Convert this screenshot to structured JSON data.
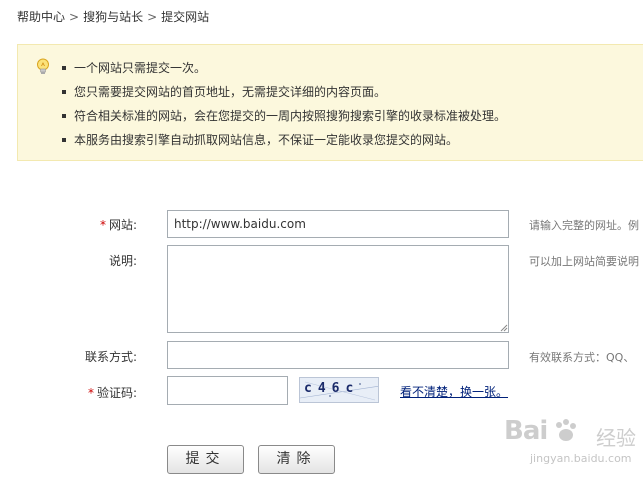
{
  "breadcrumb": {
    "items": [
      "帮助中心",
      "搜狗与站长",
      "提交网站"
    ],
    "separator": ">"
  },
  "notice": {
    "icon": "lightbulb-icon",
    "items": [
      "一个网站只需提交一次。",
      "您只需要提交网站的首页地址，无需提交详细的内容页面。",
      "符合相关标准的网站，会在您提交的一周内按照搜狗搜索引擎的收录标准被处理。",
      "本服务由搜索引擎自动抓取网站信息，不保证一定能收录您提交的网站。"
    ]
  },
  "form": {
    "required_mark": "*",
    "site": {
      "label": "网站:",
      "value": "http://www.baidu.com",
      "hint": "请输入完整的网址。例"
    },
    "description": {
      "label": "说明:",
      "value": "",
      "hint": "可以加上网站简要说明"
    },
    "contact": {
      "label": "联系方式:",
      "value": "",
      "hint": "有效联系方式：QQ、"
    },
    "captcha": {
      "label": "验证码:",
      "value": "",
      "image_text": "c46c",
      "refresh_label": "看不清楚，换一张。"
    },
    "submit_label": "提交",
    "clear_label": "清除"
  },
  "watermark": {
    "brand": "Bai",
    "brand_sub": "经验",
    "url": "jingyan.baidu.com"
  },
  "colors": {
    "notice_bg": "#fcf8dd",
    "required": "#cc0000",
    "link": "#00217a"
  }
}
